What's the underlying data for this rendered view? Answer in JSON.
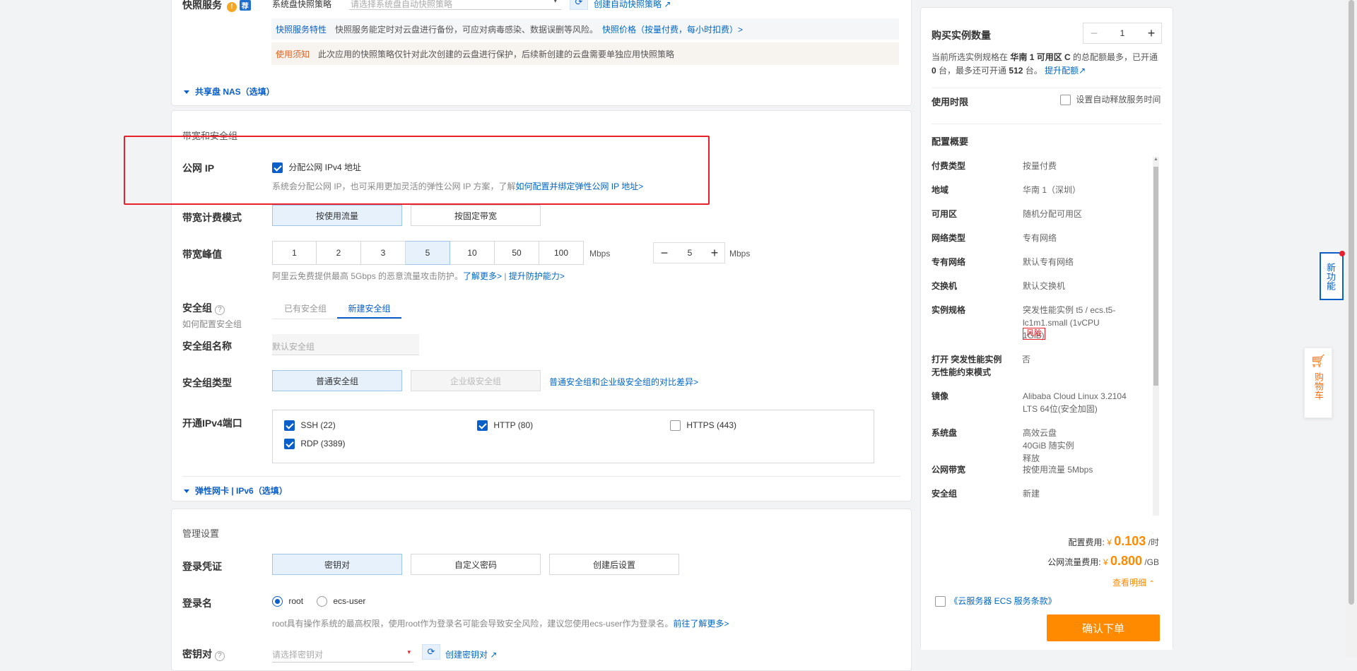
{
  "snapshot": {
    "label": "快照服务",
    "tag": "荐",
    "policy_label": "系统盘快照策略",
    "policy_placeholder": "请选择系统盘自动快照策略",
    "create_policy": "创建自动快照策略",
    "feature_tag": "快照服务特性",
    "feature_text": "快照服务能定时对云盘进行备份，可应对病毒感染、数据误删等风险。",
    "price_link": "快照价格（按量付费，每小时扣费）>",
    "notice_tag": "使用须知",
    "notice_text": "此次应用的快照策略仅针对此次创建的云盘进行保护，后续新创建的云盘需要单独应用快照策略",
    "nas_toggle": "共享盘 NAS（选填）"
  },
  "network": {
    "section_title": "带宽和安全组",
    "public_ip_label": "公网 IP",
    "public_ip_checkbox": "分配公网 IPv4 地址",
    "public_ip_checked": true,
    "public_ip_hint": "系统会分配公网 IP，也可采用更加灵活的弹性公网 IP 方案，了解",
    "public_ip_link": "如何配置并绑定弹性公网 IP 地址>",
    "billing_label": "带宽计费模式",
    "billing_options": [
      "按使用流量",
      "按固定带宽"
    ],
    "billing_selected": "按使用流量",
    "peak_label": "带宽峰值",
    "peak_options": [
      "1",
      "2",
      "3",
      "5",
      "10",
      "50",
      "100"
    ],
    "peak_selected": "5",
    "peak_unit": "Mbps",
    "peak_value": "5",
    "ddos_text": "阿里云免费提供最高 5Gbps 的恶意流量攻击防护。",
    "ddos_link1": "了解更多>",
    "ddos_sep": "|",
    "ddos_link2": "提升防护能力>",
    "sg_label": "安全组",
    "sg_sub": "如何配置安全组",
    "sg_tabs": [
      "已有安全组",
      "新建安全组"
    ],
    "sg_tab_selected": "新建安全组",
    "sg_name_label": "安全组名称",
    "sg_name_placeholder": "默认安全组",
    "sg_type_label": "安全组类型",
    "sg_type_options": [
      "普通安全组",
      "企业级安全组"
    ],
    "sg_type_link": "普通安全组和企业级安全组的对比差异>",
    "ports_label": "开通IPv4端口",
    "ports": [
      {
        "label": "SSH (22)",
        "checked": true
      },
      {
        "label": "HTTP (80)",
        "checked": true
      },
      {
        "label": "HTTPS (443)",
        "checked": false
      },
      {
        "label": "RDP (3389)",
        "checked": true
      }
    ],
    "eni_toggle": "弹性网卡 | IPv6（选填）"
  },
  "management": {
    "section_title": "管理设置",
    "cred_label": "登录凭证",
    "cred_options": [
      "密钥对",
      "自定义密码",
      "创建后设置"
    ],
    "cred_selected": "密钥对",
    "login_label": "登录名",
    "login_options": [
      "root",
      "ecs-user"
    ],
    "login_selected": "root",
    "login_hint": "root具有操作系统的最高权限，使用root作为登录名可能会导致安全风险，建议您使用ecs-user作为登录名。",
    "login_link": "前往了解更多>",
    "keypair_label": "密钥对",
    "keypair_placeholder": "请选择密钥对",
    "keypair_create": "创建密钥对"
  },
  "sidebar": {
    "qty_label": "购买实例数量",
    "qty_value": "1",
    "qty_hint_1": "当前所选实例规格在",
    "qty_hint_zone": "华南 1 可用区 C",
    "qty_hint_2": "的总配额最多，已开通",
    "qty_hint_opened": "0",
    "qty_hint_3": "台，最多还可开通",
    "qty_hint_max": "512",
    "qty_hint_4": "台。",
    "quota_link": "提升配额",
    "duration_label": "使用时限",
    "auto_release": "设置自动释放服务时间",
    "summary_title": "配置概要",
    "summary": [
      {
        "k": "付费类型",
        "v": "按量付费"
      },
      {
        "k": "地域",
        "v": "华南 1（深圳）"
      },
      {
        "k": "可用区",
        "v": "随机分配可用区"
      },
      {
        "k": "网络类型",
        "v": "专有网络"
      },
      {
        "k": "专有网络",
        "v": "默认专有网络"
      },
      {
        "k": "交换机",
        "v": "默认交换机"
      },
      {
        "k": "实例规格",
        "v": "突发性能实例 t5 / ecs.t5-lc1m1.small (1vCPU 1GiB)"
      },
      {
        "k": "打开 突发性能实例 无性能约束模式",
        "v": "否"
      },
      {
        "k": "镜像",
        "v": "Alibaba Cloud Linux 3.2104 LTS 64位(安全加固)"
      },
      {
        "k": "系统盘",
        "v": "高效云盘 40GiB 随实例释放"
      },
      {
        "k": "公网带宽",
        "v": "按使用流量 5Mbps"
      },
      {
        "k": "安全组",
        "v": "新建"
      }
    ],
    "risk_badge": "风险",
    "config_fee_label": "配置费用:",
    "config_fee_currency": "¥",
    "config_fee_value": "0.103",
    "config_fee_unit": "/时",
    "traffic_fee_label": "公网流量费用:",
    "traffic_fee_currency": "¥",
    "traffic_fee_value": "0.800",
    "traffic_fee_unit": "/GB",
    "detail_link": "查看明细",
    "terms": "《云服务器 ECS 服务条款》",
    "confirm": "确认下单"
  },
  "floating": {
    "new_feature": "新功能",
    "cart": "购物车"
  },
  "colors": {
    "accent": "#0b5fc9",
    "orange": "#ff6a00",
    "price": "#ff8a00",
    "highlight": "#e8202a"
  }
}
